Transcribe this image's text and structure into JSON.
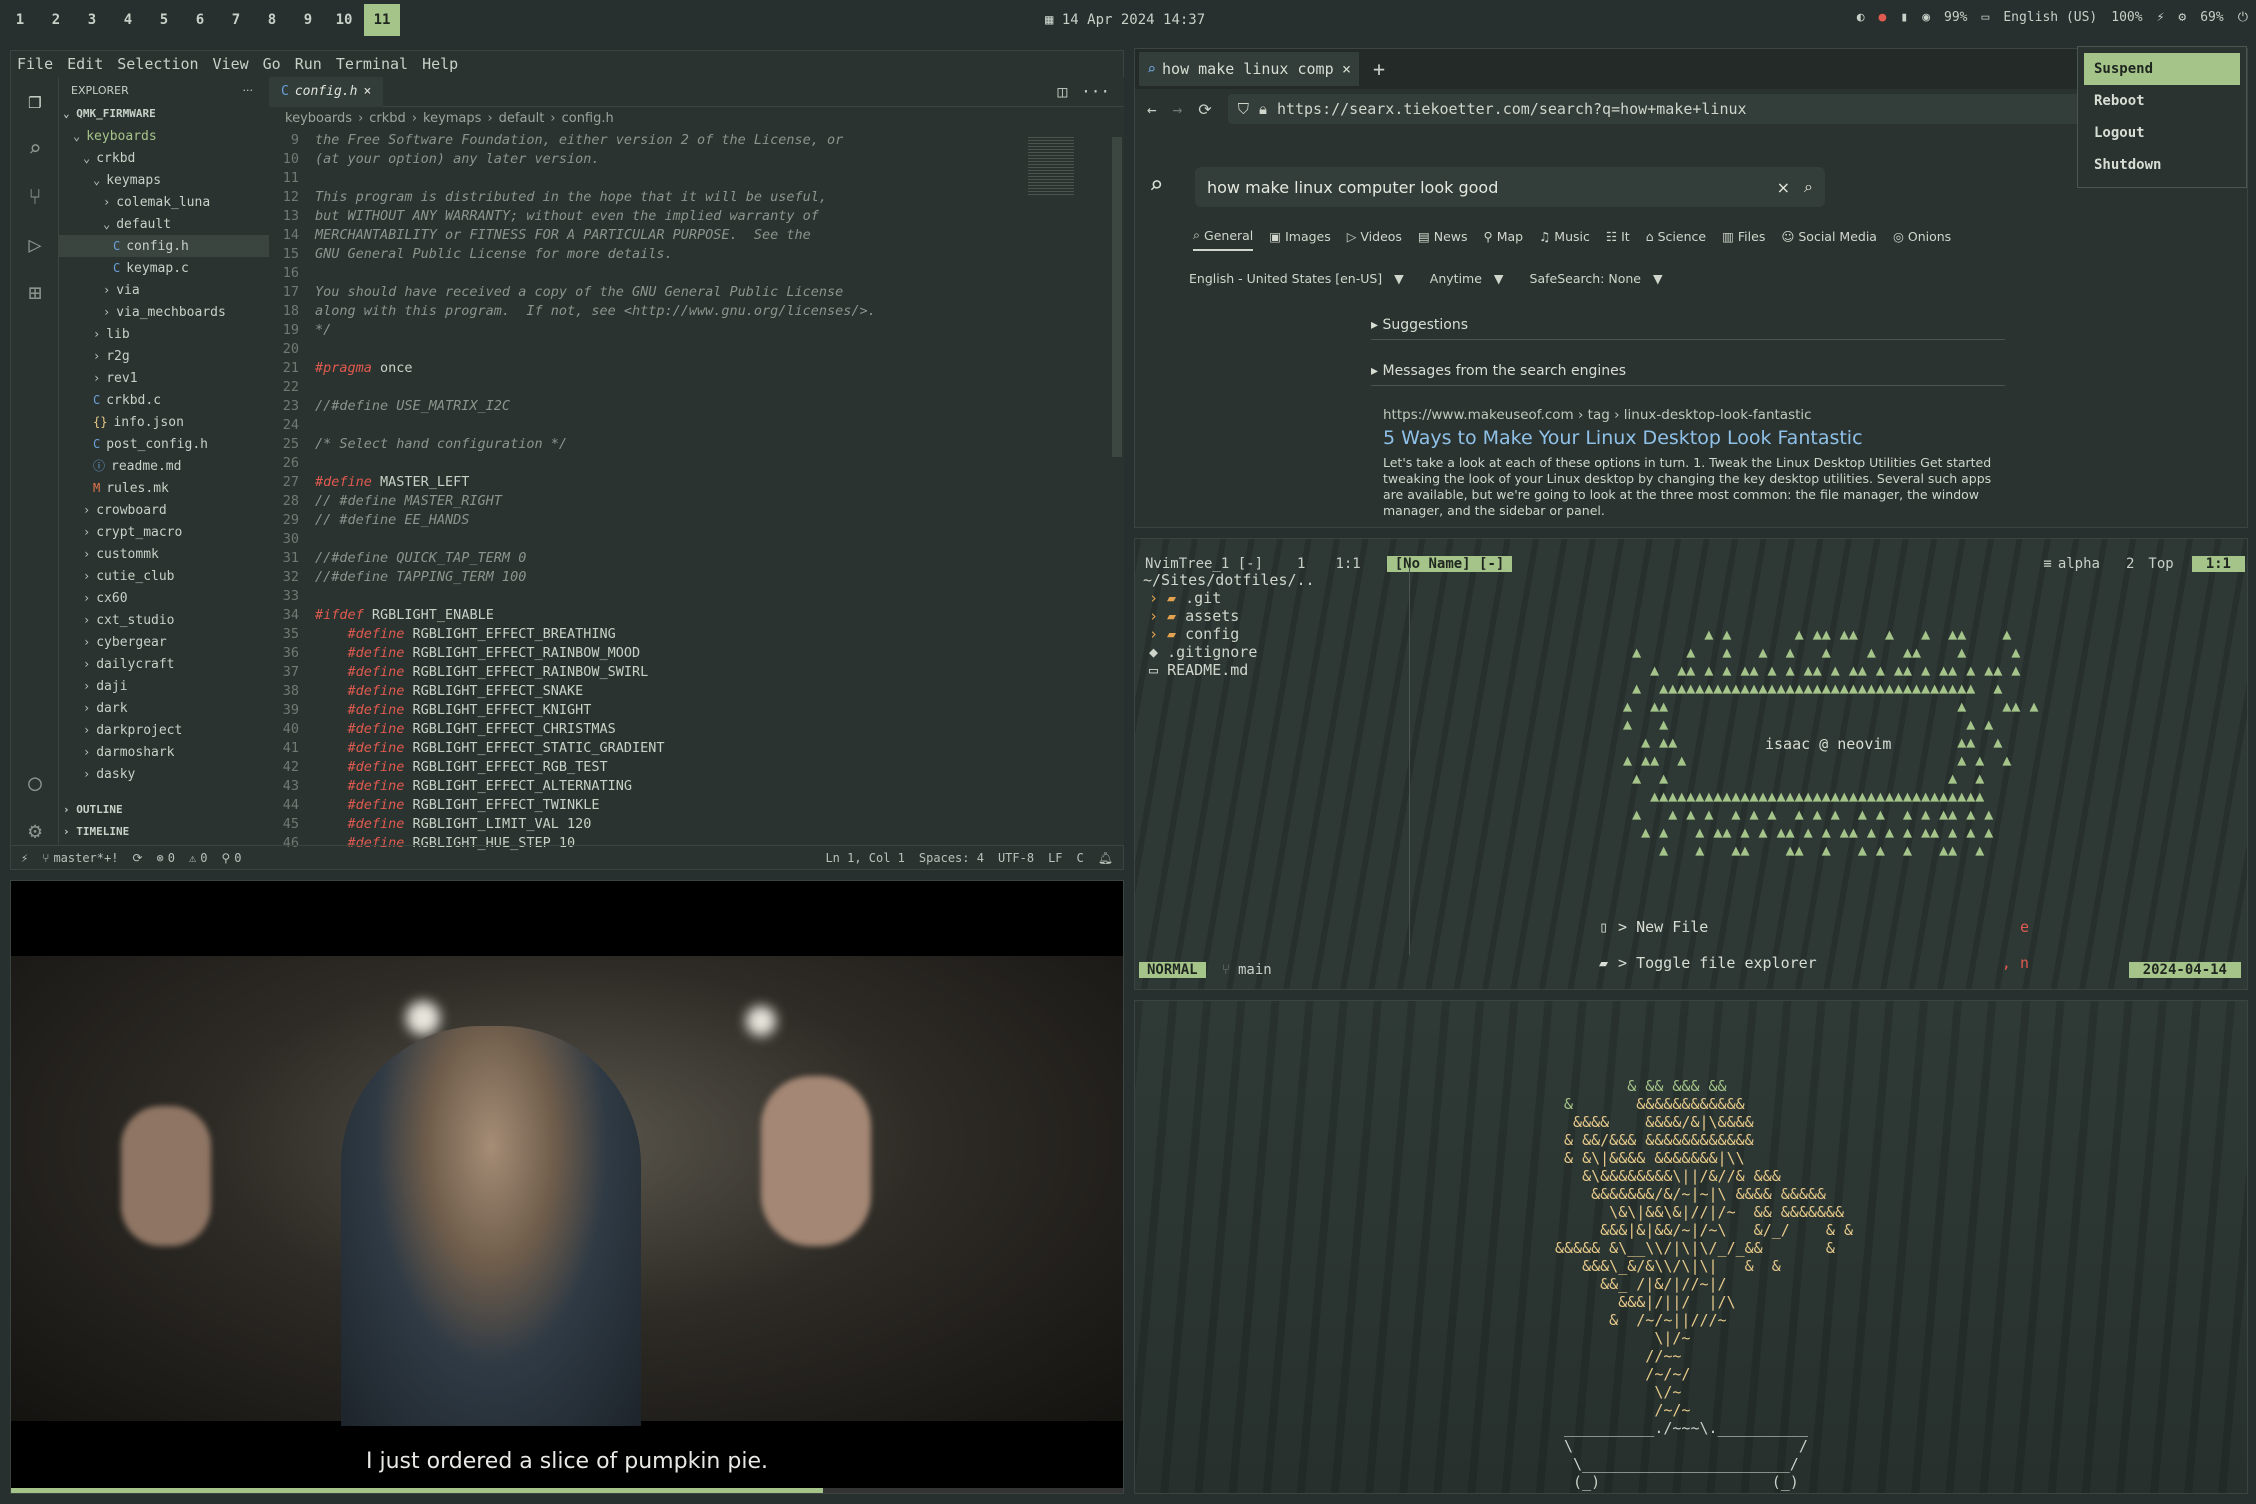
{
  "topbar": {
    "workspaces": [
      "1",
      "2",
      "3",
      "4",
      "5",
      "6",
      "7",
      "8",
      "9",
      "10",
      "11"
    ],
    "active_workspace": "11",
    "datetime": "14 Apr 2024  14:37",
    "tray": {
      "brightness": "99%",
      "keyboard": "English (US)",
      "volume": "100%",
      "battery": "69%"
    }
  },
  "vscode": {
    "menu": [
      "File",
      "Edit",
      "Selection",
      "View",
      "Go",
      "Run",
      "Terminal",
      "Help"
    ],
    "explorer_title": "EXPLORER",
    "root": "QMK_FIRMWARE",
    "tree": [
      {
        "label": "keyboards",
        "indent": 1,
        "type": "folder-open",
        "accent": true
      },
      {
        "label": "crkbd",
        "indent": 2,
        "type": "folder-open"
      },
      {
        "label": "keymaps",
        "indent": 3,
        "type": "folder-open"
      },
      {
        "label": "colemak_luna",
        "indent": 4,
        "type": "folder"
      },
      {
        "label": "default",
        "indent": 4,
        "type": "folder-open"
      },
      {
        "label": "config.h",
        "indent": 5,
        "type": "c",
        "selected": true
      },
      {
        "label": "keymap.c",
        "indent": 5,
        "type": "c"
      },
      {
        "label": "via",
        "indent": 4,
        "type": "folder"
      },
      {
        "label": "via_mechboards",
        "indent": 4,
        "type": "folder"
      },
      {
        "label": "lib",
        "indent": 3,
        "type": "folder"
      },
      {
        "label": "r2g",
        "indent": 3,
        "type": "folder"
      },
      {
        "label": "rev1",
        "indent": 3,
        "type": "folder"
      },
      {
        "label": "crkbd.c",
        "indent": 3,
        "type": "c"
      },
      {
        "label": "info.json",
        "indent": 3,
        "type": "json"
      },
      {
        "label": "post_config.h",
        "indent": 3,
        "type": "c"
      },
      {
        "label": "readme.md",
        "indent": 3,
        "type": "info"
      },
      {
        "label": "rules.mk",
        "indent": 3,
        "type": "mk"
      },
      {
        "label": "crowboard",
        "indent": 2,
        "type": "folder"
      },
      {
        "label": "crypt_macro",
        "indent": 2,
        "type": "folder"
      },
      {
        "label": "custommk",
        "indent": 2,
        "type": "folder"
      },
      {
        "label": "cutie_club",
        "indent": 2,
        "type": "folder"
      },
      {
        "label": "cx60",
        "indent": 2,
        "type": "folder"
      },
      {
        "label": "cxt_studio",
        "indent": 2,
        "type": "folder"
      },
      {
        "label": "cybergear",
        "indent": 2,
        "type": "folder"
      },
      {
        "label": "dailycraft",
        "indent": 2,
        "type": "folder"
      },
      {
        "label": "daji",
        "indent": 2,
        "type": "folder"
      },
      {
        "label": "dark",
        "indent": 2,
        "type": "folder"
      },
      {
        "label": "darkproject",
        "indent": 2,
        "type": "folder"
      },
      {
        "label": "darmoshark",
        "indent": 2,
        "type": "folder"
      },
      {
        "label": "dasky",
        "indent": 2,
        "type": "folder"
      }
    ],
    "outline": "OUTLINE",
    "timeline": "TIMELINE",
    "tab": "config.h",
    "breadcrumb": [
      "keyboards",
      "crkbd",
      "keymaps",
      "default",
      "config.h"
    ],
    "code": [
      {
        "n": "9",
        "t": "the Free Software Foundation, either version 2 of the License, or",
        "k": "cm"
      },
      {
        "n": "10",
        "t": "(at your option) any later version.",
        "k": "cm"
      },
      {
        "n": "11",
        "t": "",
        "k": "cm"
      },
      {
        "n": "12",
        "t": "This program is distributed in the hope that it will be useful,",
        "k": "cm"
      },
      {
        "n": "13",
        "t": "but WITHOUT ANY WARRANTY; without even the implied warranty of",
        "k": "cm"
      },
      {
        "n": "14",
        "t": "MERCHANTABILITY or FITNESS FOR A PARTICULAR PURPOSE.  See the",
        "k": "cm"
      },
      {
        "n": "15",
        "t": "GNU General Public License for more details.",
        "k": "cm"
      },
      {
        "n": "16",
        "t": "",
        "k": "cm"
      },
      {
        "n": "17",
        "t": "You should have received a copy of the GNU General Public License",
        "k": "cm"
      },
      {
        "n": "18",
        "t": "along with this program.  If not, see <http://www.gnu.org/licenses/>.",
        "k": "cm"
      },
      {
        "n": "19",
        "t": "*/",
        "k": "cm"
      },
      {
        "n": "20",
        "t": "",
        "k": "cm"
      },
      {
        "n": "21",
        "a": "#pragma",
        "b": " once",
        "k": "pp"
      },
      {
        "n": "22",
        "t": "",
        "k": "cm"
      },
      {
        "n": "23",
        "t": "//#define USE_MATRIX_I2C",
        "k": "cm"
      },
      {
        "n": "24",
        "t": "",
        "k": "cm"
      },
      {
        "n": "25",
        "t": "/* Select hand configuration */",
        "k": "cm"
      },
      {
        "n": "26",
        "t": "",
        "k": "cm"
      },
      {
        "n": "27",
        "a": "#define",
        "b": " MASTER_LEFT",
        "k": "pp"
      },
      {
        "n": "28",
        "t": "// #define MASTER_RIGHT",
        "k": "cm"
      },
      {
        "n": "29",
        "t": "// #define EE_HANDS",
        "k": "cm"
      },
      {
        "n": "30",
        "t": "",
        "k": "cm"
      },
      {
        "n": "31",
        "t": "//#define QUICK_TAP_TERM 0",
        "k": "cm"
      },
      {
        "n": "32",
        "t": "//#define TAPPING_TERM 100",
        "k": "cm"
      },
      {
        "n": "33",
        "t": "",
        "k": "cm"
      },
      {
        "n": "34",
        "a": "#ifdef",
        "b": " RGBLIGHT_ENABLE",
        "k": "pp"
      },
      {
        "n": "35",
        "a": "    #define",
        "b": " RGBLIGHT_EFFECT_BREATHING",
        "k": "pp"
      },
      {
        "n": "36",
        "a": "    #define",
        "b": " RGBLIGHT_EFFECT_RAINBOW_MOOD",
        "k": "pp"
      },
      {
        "n": "37",
        "a": "    #define",
        "b": " RGBLIGHT_EFFECT_RAINBOW_SWIRL",
        "k": "pp"
      },
      {
        "n": "38",
        "a": "    #define",
        "b": " RGBLIGHT_EFFECT_SNAKE",
        "k": "pp"
      },
      {
        "n": "39",
        "a": "    #define",
        "b": " RGBLIGHT_EFFECT_KNIGHT",
        "k": "pp"
      },
      {
        "n": "40",
        "a": "    #define",
        "b": " RGBLIGHT_EFFECT_CHRISTMAS",
        "k": "pp"
      },
      {
        "n": "41",
        "a": "    #define",
        "b": " RGBLIGHT_EFFECT_STATIC_GRADIENT",
        "k": "pp"
      },
      {
        "n": "42",
        "a": "    #define",
        "b": " RGBLIGHT_EFFECT_RGB_TEST",
        "k": "pp"
      },
      {
        "n": "43",
        "a": "    #define",
        "b": " RGBLIGHT_EFFECT_ALTERNATING",
        "k": "pp"
      },
      {
        "n": "44",
        "a": "    #define",
        "b": " RGBLIGHT_EFFECT_TWINKLE",
        "k": "pp"
      },
      {
        "n": "45",
        "a": "    #define",
        "b": " RGBLIGHT_LIMIT_VAL 120",
        "k": "pp"
      },
      {
        "n": "46",
        "a": "    #define",
        "b": " RGBLIGHT_HUE_STEP 10",
        "k": "pp"
      }
    ],
    "status": {
      "branch": "master*+!",
      "errors": "0",
      "warnings": "0",
      "ports": "0",
      "position": "Ln 1, Col 1",
      "spaces": "Spaces: 4",
      "encoding": "UTF-8",
      "eol": "LF",
      "lang": "C"
    }
  },
  "firefox": {
    "tab_title": "how make linux comp",
    "url": "https://searx.tiekoetter.com/search?q=how+make+linux",
    "query": "how make linux computer look good",
    "categories": [
      "General",
      "Images",
      "Videos",
      "News",
      "Map",
      "Music",
      "It",
      "Science",
      "Files",
      "Social Media",
      "Onions"
    ],
    "filters": [
      "English - United States [en-US]",
      "Anytime",
      "SafeSearch: None"
    ],
    "suggestions": "Suggestions",
    "messages": "Messages from the search engines",
    "result": {
      "url": "https://www.makeuseof.com › tag › linux-desktop-look-fantastic",
      "title": "5 Ways to Make Your Linux Desktop Look Fantastic",
      "snippet": "Let's take a look at each of these options in turn. 1. Tweak the Linux Desktop Utilities Get started tweaking the look of your Linux desktop by changing the key desktop utilities. Several such apps are available, but we're going to look at the three most common: the file manager, the window manager, and the sidebar or panel."
    }
  },
  "power_menu": {
    "items": [
      "Suspend",
      "Reboot",
      "Logout",
      "Shutdown"
    ],
    "selected": "Suspend"
  },
  "nvim": {
    "tree_title": "NvimTree_1 [-]",
    "tree_pos": "1",
    "tree_col": "1:1",
    "buffer": "[No Name] [-]",
    "filetype": "alpha",
    "buf_pos": "2",
    "top": "Top",
    "cursor": "1:1",
    "path": "~/Sites/dotfiles/..",
    "files": [
      {
        "name": ".git",
        "type": "folder"
      },
      {
        "name": "assets",
        "type": "folder"
      },
      {
        "name": "config",
        "type": "folder"
      },
      {
        "name": ".gitignore",
        "type": "file"
      },
      {
        "name": "README.md",
        "type": "md"
      }
    ],
    "greeting": "isaac @ neovim",
    "actions": [
      {
        "label": "> New File",
        "key": "e"
      },
      {
        "label": "> Toggle file explorer",
        "key": ", n"
      }
    ],
    "mode": "NORMAL",
    "branch": "main",
    "date": "2024-04-14"
  },
  "video": {
    "subtitle": "I just ordered a slice of pumpkin pie.",
    "progress": 0.73
  },
  "colors": {
    "accent": "#a5c48a",
    "keyword": "#e05a4f",
    "bg": "#2b3330"
  }
}
